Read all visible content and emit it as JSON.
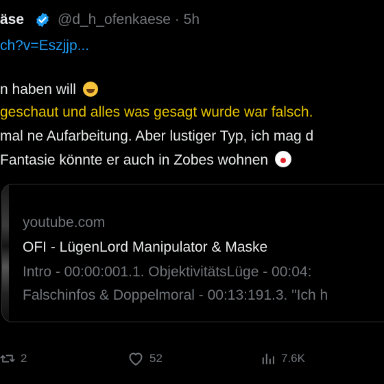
{
  "tweet": {
    "display_name": "äse",
    "handle": "@d_h_ofenkaese",
    "separator": "·",
    "time": "5h",
    "link_text": "ch?v=Eszjjp...",
    "body_lines": [
      "n haben will",
      "geschaut und alles was gesagt wurde war falsch.",
      "mal ne Aufarbeitung. Aber lustiger Typ, ich mag d",
      " Fantasie könnte er auch in Zobes wohnen"
    ],
    "emojis": [
      "rolling-on-floor-laughing",
      "clown-face"
    ]
  },
  "card": {
    "domain": "youtube.com",
    "title": "OFI - LügenLord Manipulator & Maske",
    "description_lines": [
      "Intro - 00:00:001.1. ObjektivitätsLüge - 00:04:",
      "Falschinfos & Doppelmoral - 00:13:191.3. \"Ich h"
    ]
  },
  "actions": {
    "retweets": "2",
    "likes": "52",
    "views": "7.6K"
  },
  "colors": {
    "background": "#000000",
    "text": "#e7e9ea",
    "muted": "#71767b",
    "link": "#1d9bf0",
    "verified": "#1d9bf0",
    "highlight": "#e6c400"
  }
}
